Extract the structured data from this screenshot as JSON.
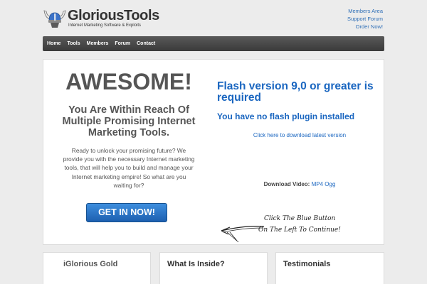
{
  "header": {
    "brand": "GloriousTools",
    "tagline": "Internet Marketing Software & Exploits",
    "top_links": [
      "Members Area",
      "Support Forum",
      "Order Now!"
    ]
  },
  "nav": {
    "items": [
      "Home",
      "Tools",
      "Members",
      "Forum",
      "Contact"
    ]
  },
  "hero": {
    "headline": "AWESOME!",
    "subheadline": "You Are Within Reach Of Multiple Promising Internet Marketing Tools.",
    "blurb": "Ready to unlock your promising future? We provide you with the necessary Internet marketing tools, that will help you to build and manage your Internet marketing empire! So what are you waiting for?",
    "cta_label": "GET IN NOW!"
  },
  "flash": {
    "title": "Flash version 9,0 or greater is required",
    "no_plugin": "You have no flash plugin installed",
    "download_link": "Click here to download latest version"
  },
  "video": {
    "label": "Download Video:",
    "mp4": "MP4",
    "ogg": "Ogg"
  },
  "hint": {
    "line1": "Click The Blue Button",
    "line2": "On The Left To Continue!"
  },
  "bottom_boxes": [
    {
      "title": "iGlorious Gold"
    },
    {
      "title": "What Is Inside?"
    },
    {
      "title": "Testimonials"
    }
  ],
  "colors": {
    "link": "#2f6fb7",
    "accent": "#1a66c0",
    "nav_bg": "#3a3a3a",
    "cta_bg": "#1d5fb0"
  }
}
